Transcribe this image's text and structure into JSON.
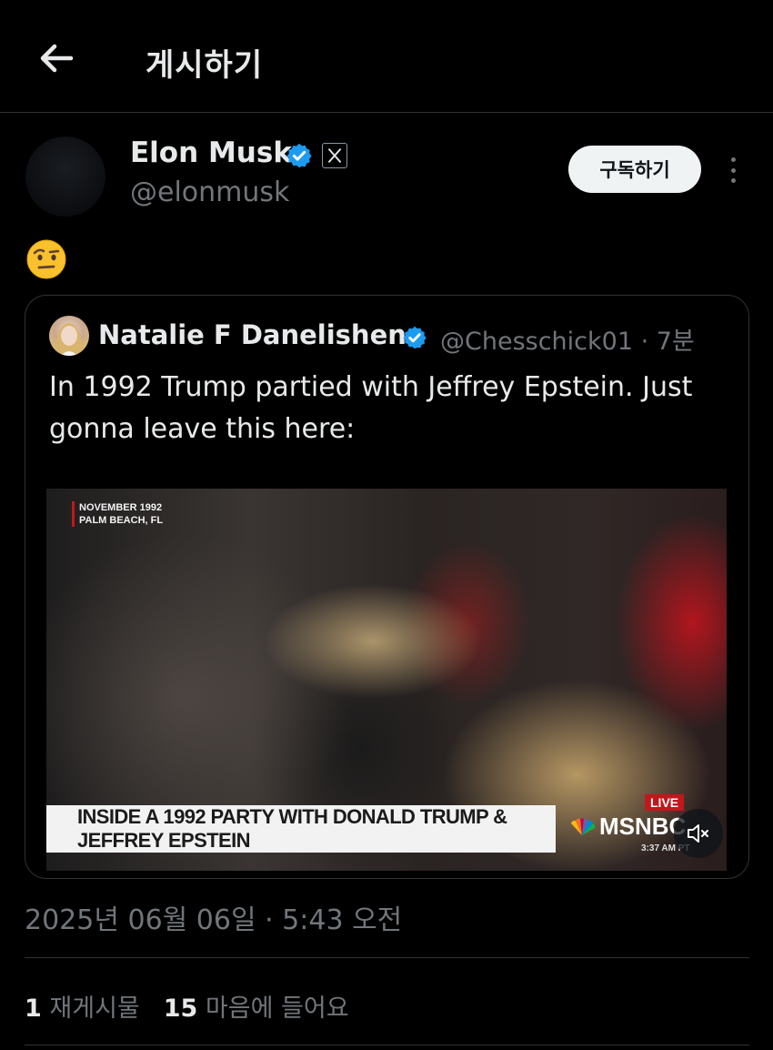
{
  "header": {
    "title": "게시하기",
    "back_icon": "arrow-left-icon"
  },
  "post": {
    "author": {
      "name": "Elon Musk",
      "handle": "@elonmusk",
      "verified_color": "#1d9bf0",
      "affiliate_badge": "X"
    },
    "subscribe_label": "구독하기",
    "more_icon": "more-vertical-icon",
    "body_emoji": "🤨",
    "quoted": {
      "author_name": "Natalie F Danelishen",
      "handle_time": "@Chesschick01 · 7분",
      "text": "In 1992 Trump partied with Jeffrey Epstein. Just gonna leave this here:",
      "video": {
        "location_line1": "NOVEMBER 1992",
        "location_line2": "PALM BEACH, FL",
        "lower_third": "INSIDE A 1992 PARTY WITH DONALD TRUMP & JEFFREY EPSTEIN",
        "live_label": "LIVE",
        "network": "MSNBC",
        "time": "3:37 AM PT",
        "mute_icon": "volume-muted-icon"
      }
    },
    "timestamp": "2025년 06월 06일 · 5:43 오전",
    "stats": {
      "reposts_count": "1",
      "reposts_label": "재게시물",
      "likes_count": "15",
      "likes_label": "마음에 들어요"
    }
  }
}
